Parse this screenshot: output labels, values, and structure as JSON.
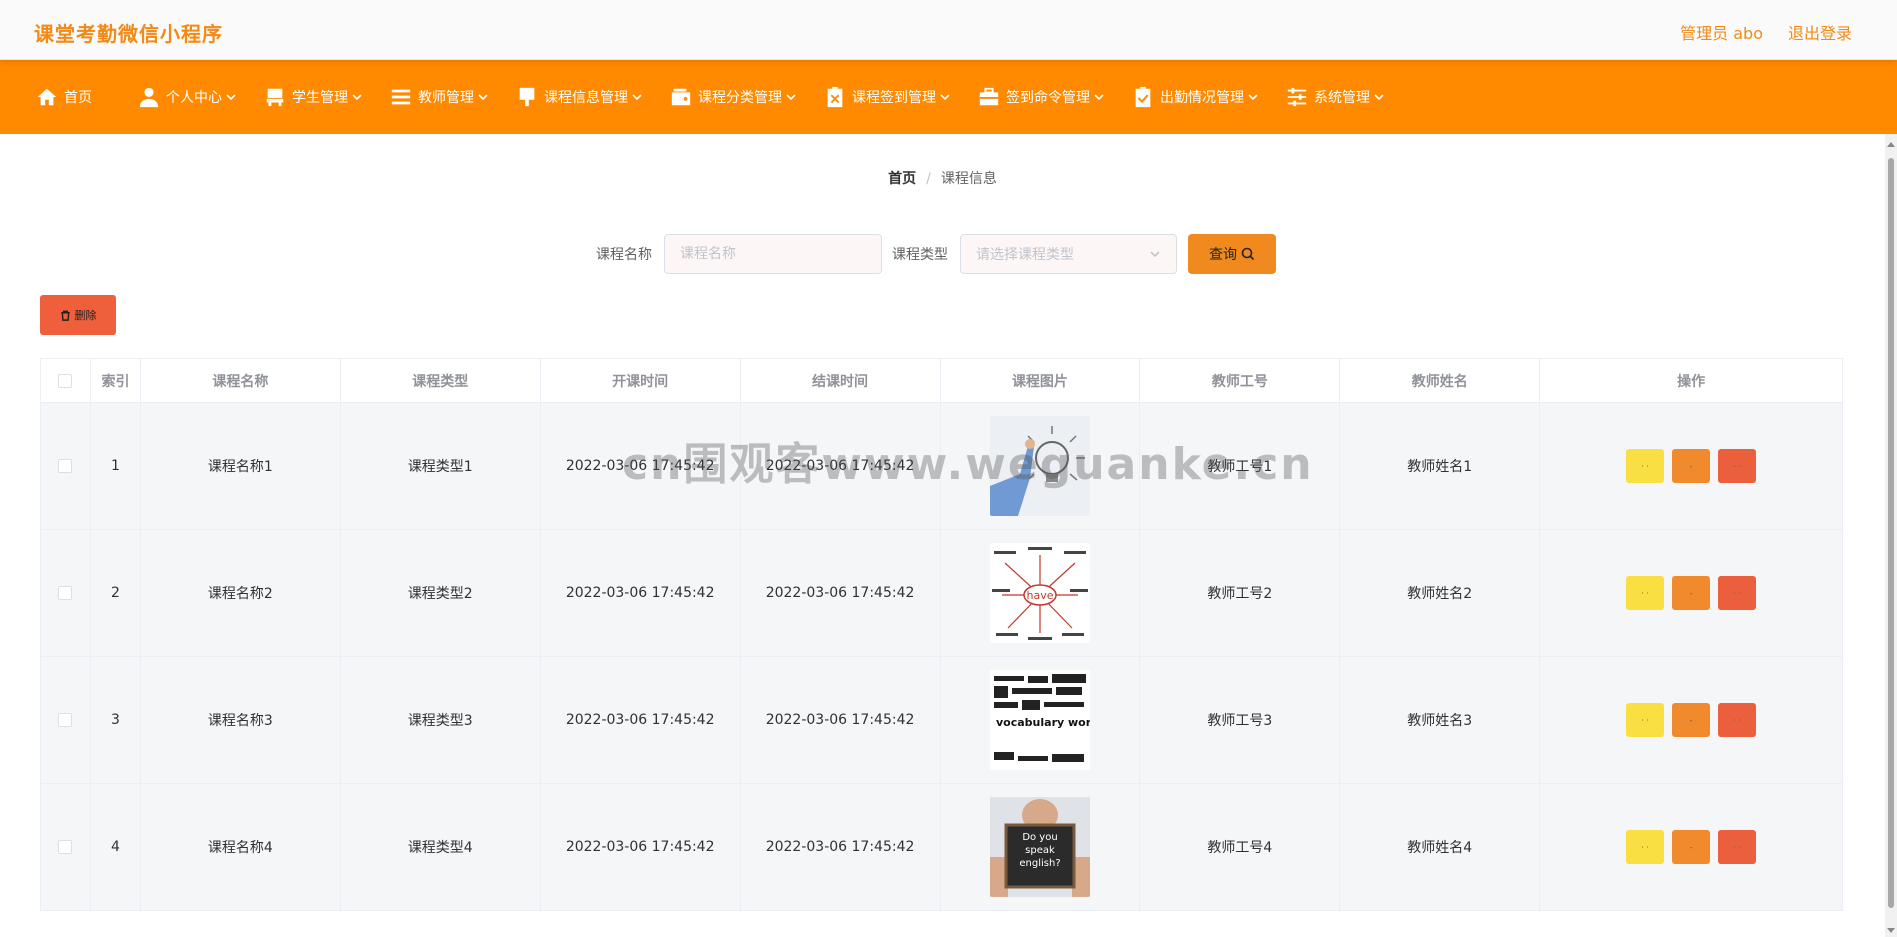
{
  "app": {
    "title": "课堂考勤微信小程序",
    "admin": "管理员 abo",
    "logout": "退出登录"
  },
  "nav": [
    {
      "label": "首页",
      "icon": "home-icon"
    },
    {
      "label": "个人中心",
      "icon": "user-icon"
    },
    {
      "label": "学生管理",
      "icon": "chair-icon"
    },
    {
      "label": "教师管理",
      "icon": "list-icon"
    },
    {
      "label": "课程信息管理",
      "icon": "brush-icon"
    },
    {
      "label": "课程分类管理",
      "icon": "wallet-icon"
    },
    {
      "label": "课程签到管理",
      "icon": "clipboard-x-icon"
    },
    {
      "label": "签到命令管理",
      "icon": "briefcase-icon"
    },
    {
      "label": "出勤情况管理",
      "icon": "clipboard-check-icon"
    },
    {
      "label": "系统管理",
      "icon": "sliders-icon"
    }
  ],
  "breadcrumb": {
    "home": "首页",
    "separator": "/",
    "current": "课程信息"
  },
  "search": {
    "name_label": "课程名称",
    "name_placeholder": "课程名称",
    "type_label": "课程类型",
    "type_placeholder": "请选择课程类型",
    "query_label": "查询"
  },
  "toolbar": {
    "delete_label": "删除"
  },
  "table": {
    "headers": [
      "索引",
      "课程名称",
      "课程类型",
      "开课时间",
      "结课时间",
      "课程图片",
      "教师工号",
      "教师姓名",
      "操作"
    ],
    "rows": [
      {
        "idx": "1",
        "name": "课程名称1",
        "type": "课程类型1",
        "start": "2022-03-06 17:45:42",
        "end": "2022-03-06 17:45:42",
        "image": "lightbulb-person-image",
        "teacher_no": "教师工号1",
        "teacher_name": "教师姓名1"
      },
      {
        "idx": "2",
        "name": "课程名称2",
        "type": "课程类型2",
        "start": "2022-03-06 17:45:42",
        "end": "2022-03-06 17:45:42",
        "image": "have-mindmap-image",
        "image_text": "have",
        "teacher_no": "教师工号2",
        "teacher_name": "教师姓名2"
      },
      {
        "idx": "3",
        "name": "课程名称3",
        "type": "课程类型3",
        "start": "2022-03-06 17:45:42",
        "end": "2022-03-06 17:45:42",
        "image": "vocabulary-words-image",
        "image_text": "vocabulary words",
        "teacher_no": "教师工号3",
        "teacher_name": "教师姓名3"
      },
      {
        "idx": "4",
        "name": "课程名称4",
        "type": "课程类型4",
        "start": "2022-03-06 17:45:42",
        "end": "2022-03-06 17:45:42",
        "image": "do-you-speak-english-image",
        "image_text": "Do you speak english?",
        "teacher_no": "教师工号4",
        "teacher_name": "教师姓名4"
      }
    ],
    "op_labels": {
      "view": "· ·",
      "edit": "-",
      "del": "· ·"
    }
  },
  "watermark": "cn围观客www.weguanke.cn",
  "colors": {
    "brand": "#ff8a00",
    "title": "#f28a15",
    "view": "#fadf43",
    "edit": "#f08a2c",
    "delete": "#ec5f3d"
  }
}
